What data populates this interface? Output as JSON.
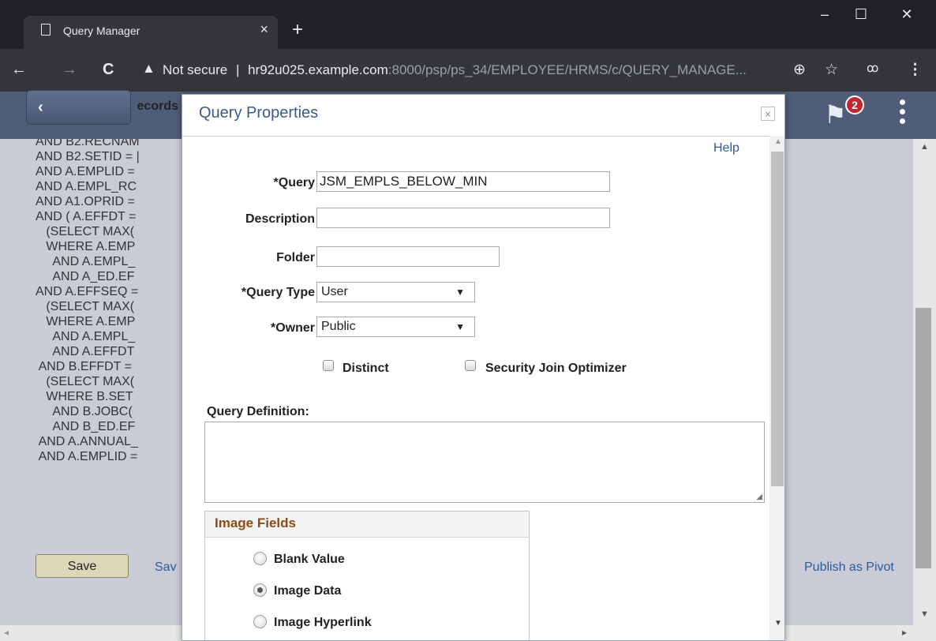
{
  "browser": {
    "tab_title": "Query Manager",
    "tab_close": "×",
    "new_tab": "+",
    "security_label": "Not secure",
    "separator": "|",
    "url_host": "hr92u025.example.com",
    "url_path": ":8000/psp/ps_34/EMPLOYEE/HRMS/c/QUERY_MANAGE...",
    "window_controls": [
      "–",
      "☐",
      "✕"
    ],
    "nav": {
      "back": "←",
      "forward": "→",
      "reload": "C"
    }
  },
  "header": {
    "back_label": "ecords",
    "back_chevron": "‹",
    "notification_count": "2"
  },
  "sql_lines": [
    "AND B2.RECNAM",
    "AND B2.SETID = |",
    "AND A.EMPLID =",
    "AND A.EMPL_RC",
    "AND A1.OPRID =",
    "AND ( A.EFFDT =",
    "   (SELECT MAX(",
    "   WHERE A.EMP",
    "     AND A.EMPL_",
    "     AND A_ED.EF",
    "AND A.EFFSEQ =",
    "   (SELECT MAX(",
    "   WHERE A.EMP",
    "     AND A.EMPL_",
    "     AND A.EFFDT",
    " AND B.EFFDT =",
    "   (SELECT MAX(",
    "   WHERE B.SET",
    "     AND B.JOBC(",
    "     AND B_ED.EF",
    " AND A.ANNUAL_",
    " AND A.EMPLID ="
  ],
  "page": {
    "save_button": "Save",
    "save_as_link": "Sav",
    "publish_link": "Publish as Pivot"
  },
  "modal": {
    "title": "Query Properties",
    "close": "×",
    "help_link": "Help",
    "fields": {
      "query_label": "*Query",
      "query_value": "JSM_EMPLS_BELOW_MIN",
      "description_label": "Description",
      "description_value": "",
      "folder_label": "Folder",
      "folder_value": "",
      "query_type_label": "*Query Type",
      "query_type_value": "User",
      "owner_label": "*Owner",
      "owner_value": "Public"
    },
    "distinct_label": "Distinct",
    "distinct_checked": false,
    "security_join_label": "Security Join Optimizer",
    "security_join_checked": false,
    "query_definition_label": "Query Definition:",
    "query_definition_value": "",
    "image_fields": {
      "title": "Image Fields",
      "options": [
        "Blank Value",
        "Image Data",
        "Image Hyperlink"
      ],
      "selected": "Image Data"
    }
  }
}
